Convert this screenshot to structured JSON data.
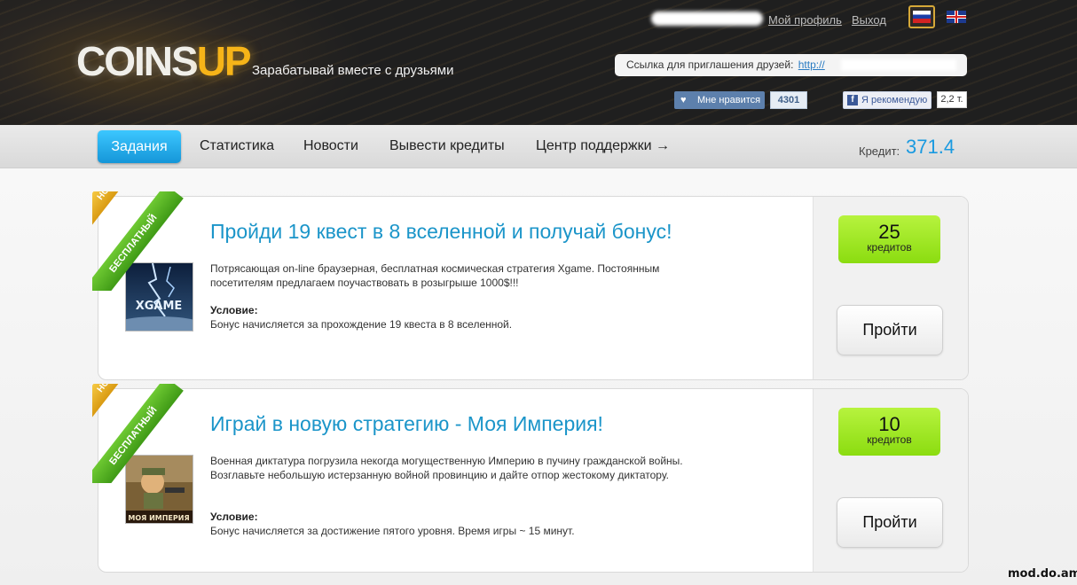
{
  "header": {
    "logo_part1": "COINS",
    "logo_part2": "UP",
    "tagline": "Зарабатывай вместе с друзьями",
    "my_profile": "Мой профиль",
    "logout": "Выход",
    "invite_label": "Ссылка для приглашения друзей:",
    "invite_url": "http://",
    "vk_like": "Мне нравится",
    "vk_count": "4301",
    "fb_recommend": "Я рекомендую",
    "fb_count": "2,2 т."
  },
  "nav": {
    "items": [
      "Задания",
      "Статистика",
      "Новости",
      "Вывести кредиты",
      "Центр поддержки →"
    ],
    "credit_label": "Кредит:",
    "credit_value": "371.4"
  },
  "tasks": [
    {
      "ribbon_new": "НОВЫЙ",
      "ribbon_free": "БЕСПЛАТНЫЙ",
      "title": "Пройди 19 квест в 8 вселенной и получай бонус!",
      "thumb_label": "XGAME",
      "description": "Потрясающая on-line браузерная, бесплатная космическая стратегия Xgame. Постоянным посетителям предлагаем поучаствовать в розыгрыше 1000$!!!",
      "condition_label": "Условие:",
      "condition": "Бонус начисляется за прохождение 19 квеста в 8 вселенной.",
      "credits": "25",
      "credits_label": "кредитов",
      "button": "Пройти"
    },
    {
      "ribbon_new": "НОВЫЙ",
      "ribbon_free": "БЕСПЛАТНЫЙ",
      "title": "Играй в новую стратегию - Моя Империя!",
      "thumb_label": "МОЯ ИМПЕРИЯ",
      "description": "Военная диктатура погрузила некогда могущественную Империю в пучину гражданской войны. Возглавьте небольшую истерзанную войной провинцию и дайте отпор жестокому диктатору.",
      "condition_label": "Условие:",
      "condition": "Бонус начисляется за достижение пятого уровня. Время игры ~ 15 минут.",
      "credits": "10",
      "credits_label": "кредитов",
      "button": "Пройти"
    }
  ],
  "watermark": "mod.do.am",
  "colors": {
    "accent": "#1a9ae0",
    "logo_yellow": "#f6b418",
    "badge_green": "#9be61f"
  }
}
